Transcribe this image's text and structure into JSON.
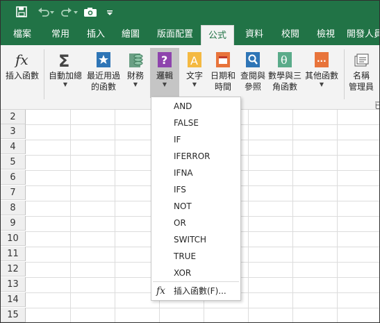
{
  "qat": {
    "save_icon": "save-icon",
    "undo_icon": "undo-icon",
    "redo_icon": "redo-icon",
    "camera_icon": "camera-icon",
    "customize_icon": "customize-qat-icon"
  },
  "tabs": [
    {
      "label": "檔案"
    },
    {
      "label": "常用"
    },
    {
      "label": "插入"
    },
    {
      "label": "繪圖"
    },
    {
      "label": "版面配置"
    },
    {
      "label": "公式"
    },
    {
      "label": "資料"
    },
    {
      "label": "校閱"
    },
    {
      "label": "檢視"
    },
    {
      "label": "開發人員"
    }
  ],
  "ribbon": {
    "insert_function": "插入函數",
    "autosum_1": "自動加總",
    "recent_1": "最近用過",
    "recent_2": "的函數",
    "financial": "財務",
    "logical": "邏輯",
    "text": "文字",
    "datetime_1": "日期和",
    "datetime_2": "時間",
    "lookup_1": "查閱與",
    "lookup_2": "參照",
    "math_1": "數學與三",
    "math_2": "角函數",
    "more": "其他函數",
    "name_1": "名稱",
    "name_2": "管理員",
    "ribbon_cut": "已"
  },
  "rows": [
    "2",
    "3",
    "4",
    "5",
    "6",
    "7",
    "8",
    "9",
    "10",
    "11",
    "12",
    "13",
    "14",
    "15"
  ],
  "dropdown": {
    "items": [
      "AND",
      "FALSE",
      "IF",
      "IFERROR",
      "IFNA",
      "IFS",
      "NOT",
      "OR",
      "SWITCH",
      "TRUE",
      "XOR"
    ],
    "footer": "插入函數(F)..."
  },
  "colors": {
    "brand": "#217346",
    "ribbon_bg": "#f3f3f3",
    "active_button": "#c5c5c5"
  }
}
